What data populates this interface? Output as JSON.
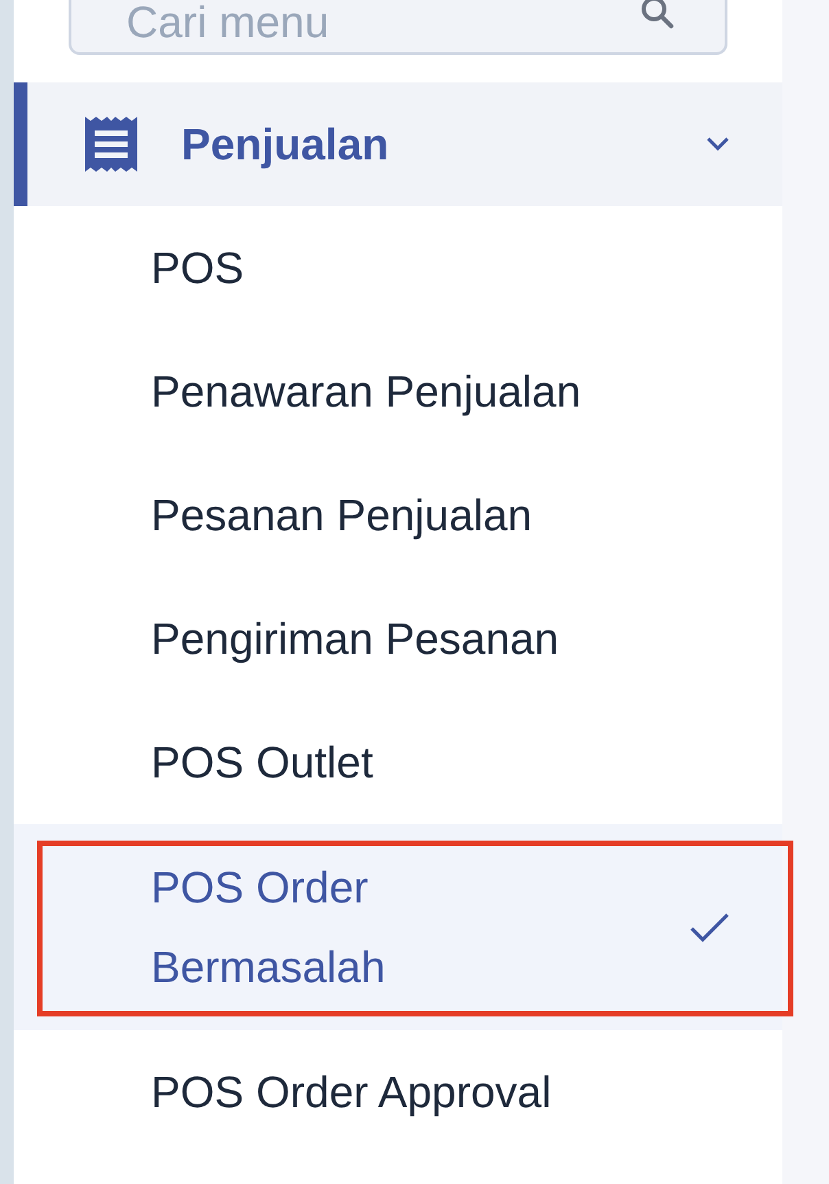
{
  "search": {
    "placeholder": "Cari menu"
  },
  "menu": [
    {
      "label": "Penjualan",
      "expanded": true,
      "selected": true,
      "children": [
        {
          "label": "POS",
          "selected": false
        },
        {
          "label": "Penawaran Penjualan",
          "selected": false
        },
        {
          "label": "Pesanan Penjualan",
          "selected": false
        },
        {
          "label": "Pengiriman Pesanan",
          "selected": false
        },
        {
          "label": "POS Outlet",
          "selected": false
        },
        {
          "label": "POS Order Bermasalah",
          "selected": true,
          "annotated": true
        },
        {
          "label": "POS Order Approval",
          "selected": false
        }
      ]
    }
  ]
}
